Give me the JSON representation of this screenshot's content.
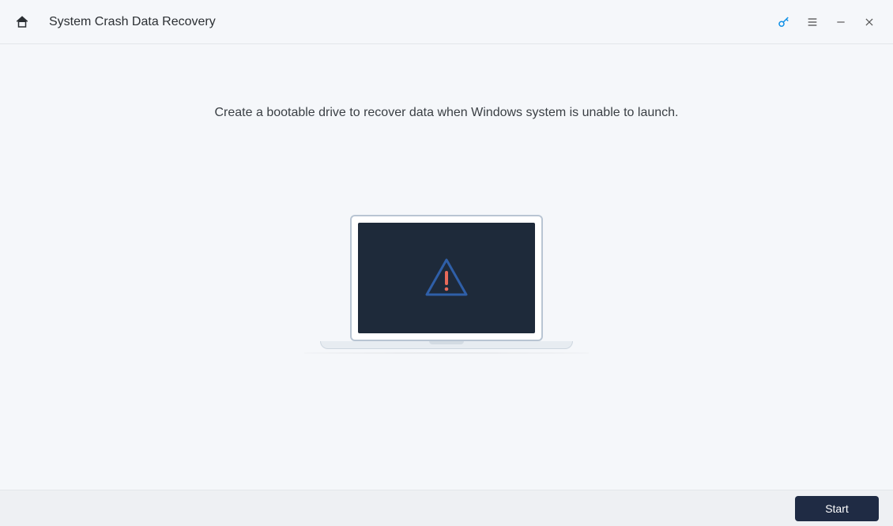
{
  "header": {
    "title": "System Crash Data Recovery"
  },
  "main": {
    "subtitle": "Create a bootable drive to recover data when Windows system is unable to launch."
  },
  "footer": {
    "start_label": "Start"
  },
  "icons": {
    "home": "home-icon",
    "key": "key-icon",
    "menu": "menu-icon",
    "minimize": "minimize-icon",
    "close": "close-icon",
    "warning": "warning-triangle-icon"
  },
  "colors": {
    "accent": "#0e8fe6",
    "button_bg": "#1f2b44",
    "screen_bg": "#1e2a3a",
    "warning_outline": "#2f5fa8",
    "warning_mark": "#e96a5a"
  }
}
